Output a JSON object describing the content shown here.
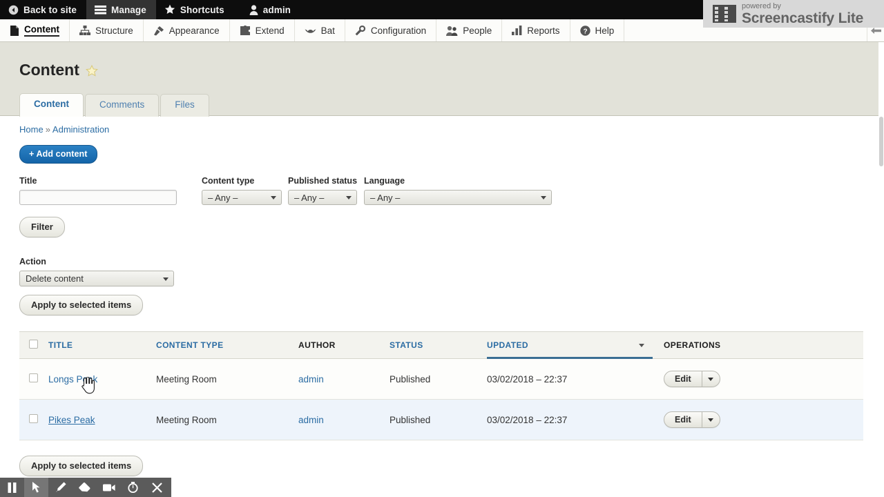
{
  "admin_toolbar": {
    "items": [
      {
        "label": "Back to site",
        "icon": "back-arrow-icon",
        "active": false
      },
      {
        "label": "Manage",
        "icon": "hamburger-icon",
        "active": true
      },
      {
        "label": "Shortcuts",
        "icon": "star-icon",
        "active": false
      },
      {
        "label": "admin",
        "icon": "user-icon",
        "active": false
      }
    ]
  },
  "watermark": {
    "powered_by": "powered by",
    "name": "Screencastify Lite",
    "icon": "film-strip-icon"
  },
  "menu": {
    "items": [
      {
        "label": "Content",
        "icon": "content-page-icon",
        "active": true
      },
      {
        "label": "Structure",
        "icon": "structure-tree-icon",
        "active": false
      },
      {
        "label": "Appearance",
        "icon": "paintbrush-icon",
        "active": false
      },
      {
        "label": "Extend",
        "icon": "puzzle-piece-icon",
        "active": false
      },
      {
        "label": "Bat",
        "icon": "bat-icon",
        "active": false
      },
      {
        "label": "Configuration",
        "icon": "wrench-icon",
        "active": false
      },
      {
        "label": "People",
        "icon": "people-icon",
        "active": false
      },
      {
        "label": "Reports",
        "icon": "bar-chart-icon",
        "active": false
      },
      {
        "label": "Help",
        "icon": "question-mark-icon",
        "active": false
      }
    ],
    "collapse_icon": "arrow-left-icon"
  },
  "page": {
    "title": "Content",
    "shortcut_star_icon": "star-outline-icon"
  },
  "tabs": [
    {
      "label": "Content",
      "active": true
    },
    {
      "label": "Comments",
      "active": false
    },
    {
      "label": "Files",
      "active": false
    }
  ],
  "breadcrumb": {
    "home": "Home",
    "separator": "»",
    "current": "Administration"
  },
  "actions": {
    "add_content": "+ Add content",
    "filter_button": "Filter",
    "apply_top": "Apply to selected items",
    "apply_bottom": "Apply to selected items"
  },
  "filters": {
    "title": {
      "label": "Title",
      "value": "",
      "placeholder": ""
    },
    "content_type": {
      "label": "Content type",
      "value": "– Any –"
    },
    "published_status": {
      "label": "Published status",
      "value": "– Any –"
    },
    "language": {
      "label": "Language",
      "value": "– Any –"
    }
  },
  "action_select": {
    "label": "Action",
    "value": "Delete content"
  },
  "table": {
    "columns": [
      {
        "label": "TITLE",
        "sortable": true,
        "sorted": false
      },
      {
        "label": "CONTENT TYPE",
        "sortable": true,
        "sorted": false
      },
      {
        "label": "AUTHOR",
        "sortable": false,
        "sorted": false
      },
      {
        "label": "STATUS",
        "sortable": true,
        "sorted": false
      },
      {
        "label": "UPDATED",
        "sortable": true,
        "sorted": true
      },
      {
        "label": "OPERATIONS",
        "sortable": false,
        "sorted": false
      }
    ],
    "rows": [
      {
        "title": "Longs Peak",
        "content_type": "Meeting Room",
        "author": "admin",
        "status": "Published",
        "updated": "03/02/2018 – 22:37",
        "operation": "Edit",
        "hovered": false
      },
      {
        "title": "Pikes Peak",
        "content_type": "Meeting Room",
        "author": "admin",
        "status": "Published",
        "updated": "03/02/2018 – 22:37",
        "operation": "Edit",
        "hovered": true
      }
    ]
  },
  "recorder_bar": {
    "buttons": [
      {
        "icon": "pause-icon",
        "active": false
      },
      {
        "icon": "cursor-arrow-icon",
        "active": true
      },
      {
        "icon": "pen-icon",
        "active": false
      },
      {
        "icon": "eraser-icon",
        "active": false
      },
      {
        "icon": "video-camera-icon",
        "active": false
      },
      {
        "icon": "timer-icon",
        "active": false
      },
      {
        "icon": "close-x-icon",
        "active": false
      }
    ]
  },
  "colors": {
    "link_blue": "#2b6ca3",
    "button_blue": "#1f72b5",
    "header_band": "#e2e2d9",
    "toolbar_black": "#0d0d0d",
    "row_hover": "#eef4fb",
    "sort_underline": "#3a6e93"
  }
}
